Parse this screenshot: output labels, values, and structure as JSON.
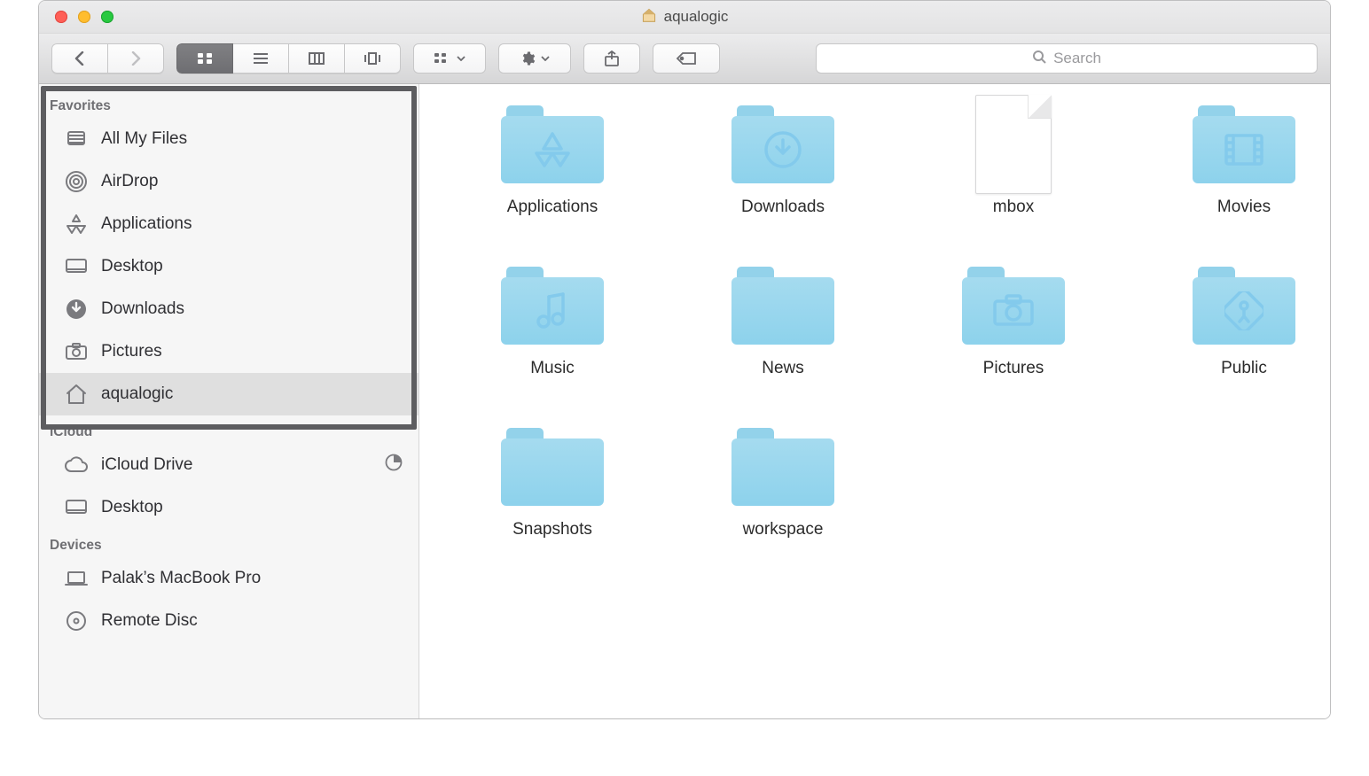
{
  "window": {
    "title": "aqualogic"
  },
  "toolbar": {
    "search_placeholder": "Search"
  },
  "sidebar": {
    "sections": [
      {
        "header": "Favorites",
        "items": [
          {
            "icon": "all-my-files",
            "label": "All My Files"
          },
          {
            "icon": "airdrop",
            "label": "AirDrop"
          },
          {
            "icon": "applications",
            "label": "Applications"
          },
          {
            "icon": "desktop",
            "label": "Desktop"
          },
          {
            "icon": "downloads",
            "label": "Downloads"
          },
          {
            "icon": "pictures",
            "label": "Pictures"
          },
          {
            "icon": "home",
            "label": "aqualogic",
            "selected": true
          }
        ]
      },
      {
        "header": "iCloud",
        "items": [
          {
            "icon": "icloud",
            "label": "iCloud Drive",
            "trail": "pie"
          },
          {
            "icon": "desktop",
            "label": "Desktop"
          }
        ]
      },
      {
        "header": "Devices",
        "items": [
          {
            "icon": "laptop",
            "label": "Palak’s MacBook Pro"
          },
          {
            "icon": "disc",
            "label": "Remote Disc"
          }
        ]
      }
    ],
    "highlighted_section_index": 0
  },
  "grid": {
    "items": [
      {
        "kind": "folder",
        "glyph": "applications",
        "label": "Applications"
      },
      {
        "kind": "folder",
        "glyph": "downloads",
        "label": "Downloads"
      },
      {
        "kind": "file",
        "glyph": "",
        "label": "mbox"
      },
      {
        "kind": "folder",
        "glyph": "movies",
        "label": "Movies"
      },
      {
        "kind": "folder",
        "glyph": "music",
        "label": "Music"
      },
      {
        "kind": "folder",
        "glyph": "",
        "label": "News"
      },
      {
        "kind": "folder",
        "glyph": "pictures",
        "label": "Pictures"
      },
      {
        "kind": "folder",
        "glyph": "public",
        "label": "Public"
      },
      {
        "kind": "folder",
        "glyph": "",
        "label": "Snapshots"
      },
      {
        "kind": "folder",
        "glyph": "",
        "label": "workspace"
      }
    ]
  }
}
